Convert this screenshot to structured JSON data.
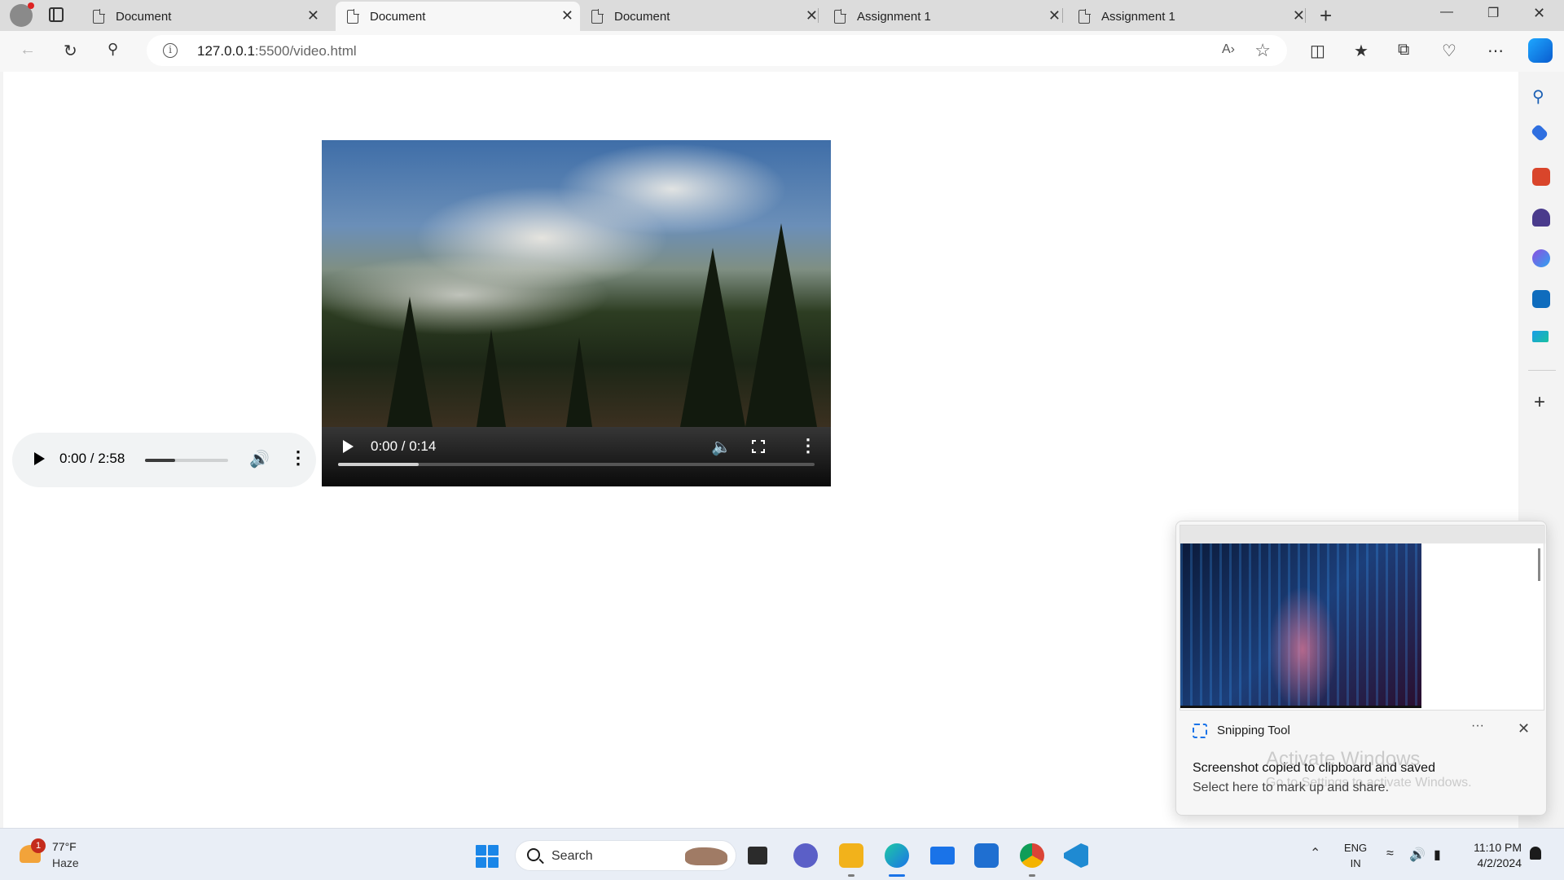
{
  "browser": {
    "tabs": [
      {
        "label": "Document",
        "active": false
      },
      {
        "label": "Document",
        "active": true
      },
      {
        "label": "Document",
        "active": false
      },
      {
        "label": "Assignment 1",
        "active": false
      },
      {
        "label": "Assignment 1",
        "active": false
      }
    ],
    "close_glyph": "✕",
    "new_tab_glyph": "+",
    "url_host": "127.0.0.1",
    "url_path": ":5500/video.html"
  },
  "audio_player": {
    "time": "0:00 / 2:58",
    "volume_level": 0.36
  },
  "video_player": {
    "time": "0:00 / 0:14",
    "progress": 0.17
  },
  "notification": {
    "app_name": "Snipping Tool",
    "more_glyph": "···",
    "close_glyph": "✕",
    "title": "Screenshot copied to clipboard and saved",
    "body": "Select here to mark up and share.",
    "watermark_title": "Activate Windows",
    "watermark_body": "Go to Settings to activate Windows."
  },
  "taskbar": {
    "weather_badge": "1",
    "temperature": "77°F",
    "condition": "Haze",
    "search_label": "Search",
    "language_line1": "ENG",
    "language_line2": "IN",
    "time": "11:10 PM",
    "date": "4/2/2024"
  },
  "colors": {
    "accent": "#1a73e8",
    "page_bg": "#ffffff",
    "chrome_bg": "#f7f7f7"
  },
  "icons": [
    "profile-icon",
    "tab-actions-icon",
    "document-icon",
    "back-icon",
    "refresh-icon",
    "search-icon",
    "info-icon",
    "read-aloud-icon",
    "favorite-star-icon",
    "split-screen-icon",
    "favorites-icon",
    "collections-icon",
    "browser-essentials-icon",
    "more-icon",
    "copilot-icon"
  ]
}
